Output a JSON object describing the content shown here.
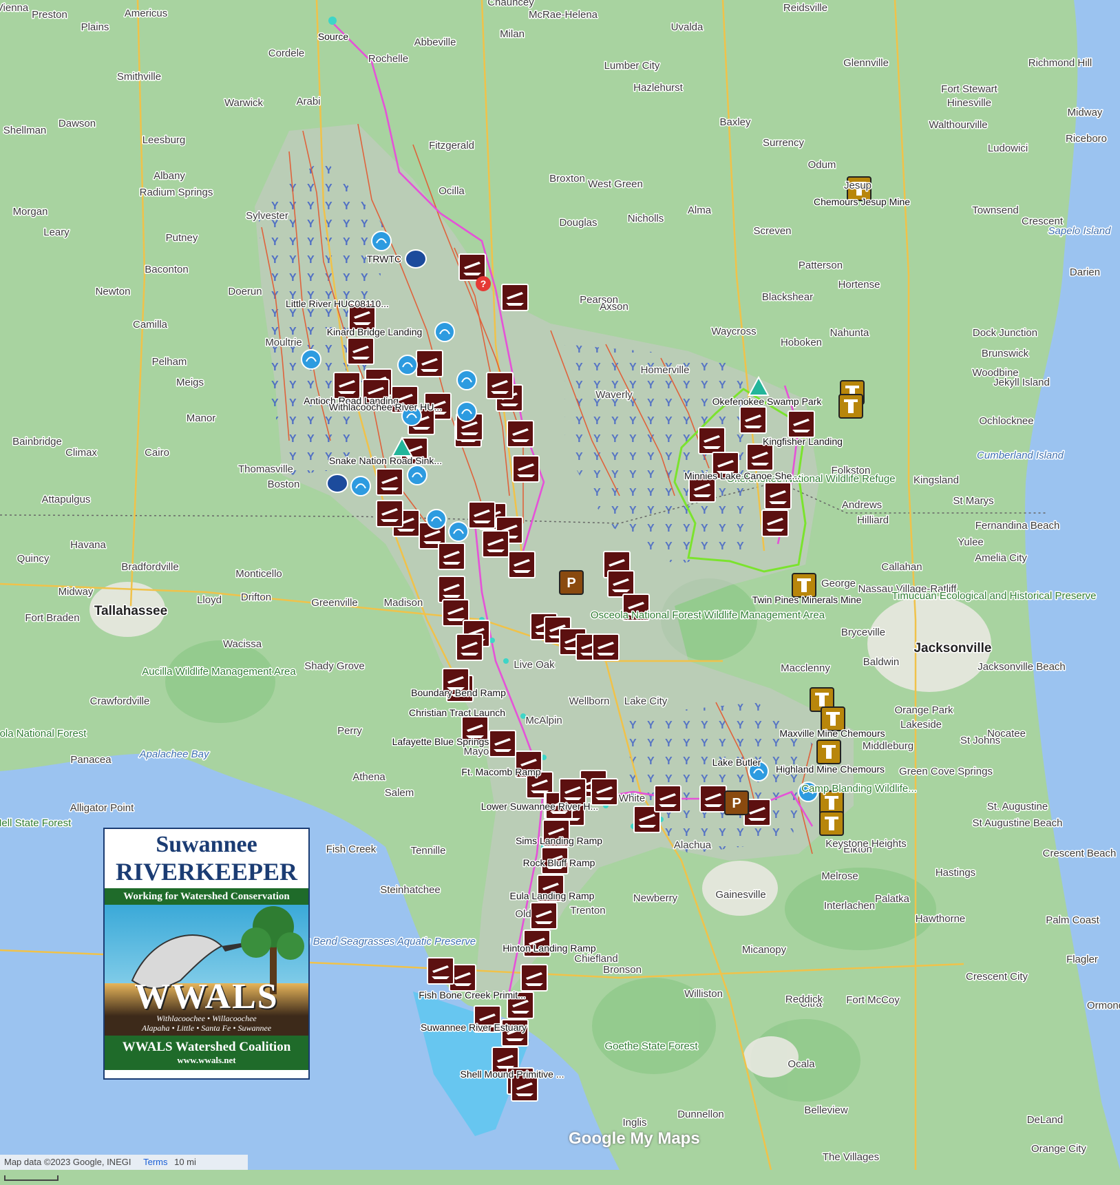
{
  "colors": {
    "land": "#a8d3a0",
    "forest": "#8fc98a",
    "water": "#9bc3f0",
    "estuary": "#62c7ef",
    "watershed": "#c9c9c9",
    "river_red": "#e4572e",
    "river_pink": "#e552d8",
    "trail_green": "#7be32e",
    "marker_boat": "#5c1010",
    "marker_spring": "#2d9be0",
    "marker_mine": "#b8860b"
  },
  "labels": {
    "cities": [
      "Vienna",
      "Preston",
      "Americus",
      "Plains",
      "Cordele",
      "Chauncey",
      "McRae-Helena",
      "Reidsville",
      "Uvalda",
      "Abbeville",
      "Milan",
      "Rochelle",
      "Glennville",
      "Lumber City",
      "Hazlehurst",
      "Richmond Hill",
      "Smithville",
      "Arabi",
      "Warwick",
      "Dawson",
      "Shellman",
      "Leesburg",
      "Baxley",
      "Surrency",
      "Fort Stewart",
      "Hinesville",
      "Midway",
      "Walthourville",
      "Riceboro",
      "Ludowici",
      "Fitzgerald",
      "Broxton",
      "West Green",
      "Odum",
      "Jesup",
      "Albany",
      "Radium Springs",
      "Putney",
      "Morgan",
      "Leary",
      "Sylvester",
      "Ocilla",
      "Douglas",
      "Nicholls",
      "Alma",
      "Screven",
      "Townsend",
      "Crescent",
      "Baconton",
      "Newton",
      "Doerun",
      "Camilla",
      "Patterson",
      "Hortense",
      "Darien",
      "Pearson",
      "Axson",
      "Blackshear",
      "Nahunta",
      "Waycross",
      "Hoboken",
      "Dock Junction",
      "Brunswick",
      "Jekyll Island",
      "Moultrie",
      "Pelham",
      "Meigs",
      "Manor",
      "Homerville",
      "Waverly",
      "Woodbine",
      "Ochlocknee",
      "Bainbridge",
      "Climax",
      "Cairo",
      "Thomasville",
      "Folkston",
      "Kingsland",
      "St Marys",
      "Attapulgus",
      "Boston",
      "Andrews",
      "Hilliard",
      "Yulee",
      "Fernandina Beach",
      "Havana",
      "Quincy",
      "Callahan",
      "Amelia City",
      "Nassau Village-Ratliff",
      "Bradfordville",
      "Monticello",
      "Midway",
      "Drifton",
      "Lloyd",
      "Greenville",
      "Madison",
      "George",
      "Wacissa",
      "Live Oak",
      "Bryceville",
      "Fort Braden",
      "Shady Grove",
      "Baldwin",
      "Macclenny",
      "Jacksonville Beach",
      "Crawfordville",
      "Wellborn",
      "Lake City",
      "Orange Park",
      "Lakeside",
      "Perry",
      "McAlpin",
      "St Johns",
      "Nocatee",
      "Middleburg",
      "Mayo",
      "Panacea",
      "Athena",
      "Green Cove Springs",
      "Salem",
      "Alligator Point",
      "St. Augustine",
      "St Augustine Beach",
      "Fish Creek",
      "Tennille",
      "Elkton",
      "Crescent Beach",
      "Hastings",
      "Melrose",
      "Steinhatchee",
      "Trenton",
      "Newberry",
      "Gainesville",
      "Interlachen",
      "Palatka",
      "Hawthorne",
      "Palm Coast",
      "Micanopy",
      "Chiefland",
      "Bronson",
      "Crescent City",
      "Flagler",
      "Williston",
      "Citra",
      "Reddick",
      "Fort McCoy",
      "Ormond",
      "Ocala",
      "Inglis",
      "Dunnellon",
      "Belleview",
      "DeLand",
      "Orange City",
      "The Villages",
      "Keystone Heights",
      "Old",
      "Alachua",
      "White"
    ],
    "major": [
      "Tallahassee",
      "Jacksonville"
    ],
    "water": [
      "Apalachee Bay",
      "Sapelo Island",
      "Cumberland Island",
      "Big Bend Seagrasses Aquatic Preserve"
    ],
    "parks": [
      "Osceola National Forest Wildlife Management Area",
      "Aucilla Wildlife Management Area",
      "Timucuan Ecological and Historical Preserve",
      "Camp Blanding Wildlife...",
      "Goethe State Forest",
      "Okefenokee National Wildlife Refuge",
      "Apalachicola National Forest",
      "Tate's Hell State Forest"
    ],
    "features": [
      "Source",
      "TRWTC",
      "Little River HUC08110...",
      "Kinard Bridge Landing",
      "Antioch Road Landing",
      "Withlacoochee River HU...",
      "Snake Nation Road Sink...",
      "Okefenokee Swamp Park",
      "Kingfisher Landing",
      "Minnies Lake Canoe She...",
      "Twin Pines Minerals Mine",
      "Chemours Jesup Mine",
      "Boundary Bend Ramp",
      "Christian Tract Launch",
      "Lafayette Blue Springs",
      "Ft. Macomb Ramp",
      "Lower Suwannee River H...",
      "Sims Landing Ramp",
      "Rock Bluff Ramp",
      "Eula Landing Ramp",
      "Hinton Landing Ramp",
      "Fish Bone Creek Primit...",
      "Suwannee River Estuary",
      "Shell Mound Primitive ...",
      "Maxville Mine Chemours",
      "Highland Mine Chemours",
      "Lake Butler"
    ]
  },
  "logo": {
    "line1": "Suwannee",
    "line2": "RIVERKEEPER",
    "tagline": "Working for Watershed Conservation",
    "big": "WWALS",
    "rivers1": "Withlacoochee • Willacoochee",
    "rivers2": "Alapaha • Little • Santa Fe • Suwannee",
    "name": "WWALS Watershed Coalition",
    "url": "www.wwals.net"
  },
  "footer": {
    "attribution": "Map data ©2023 Google, INEGI",
    "terms": "Terms",
    "scale": "10 mi"
  },
  "brand": "Google My Maps",
  "icons": [
    "boat-ramp-icon",
    "spring-icon",
    "sink-icon",
    "mine-icon",
    "parking-icon",
    "campground-icon",
    "question-icon",
    "waterfall-icon",
    "wetland-icon"
  ]
}
